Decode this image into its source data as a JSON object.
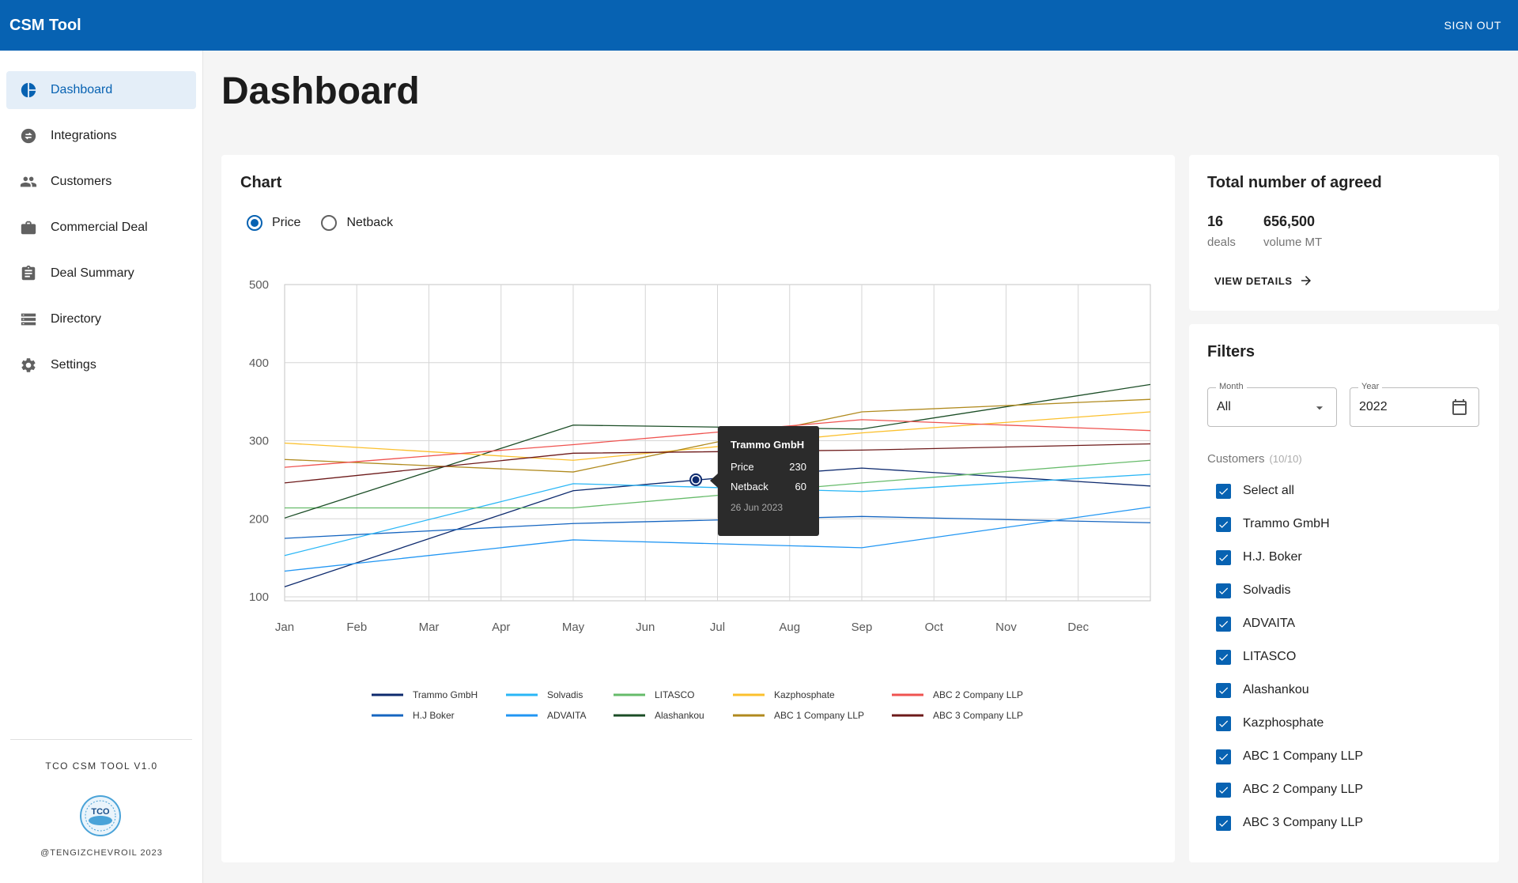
{
  "app": {
    "title": "CSM Tool",
    "sign_out": "SIGN OUT"
  },
  "sidebar": {
    "items": [
      {
        "label": "Dashboard",
        "icon": "pie-chart-icon",
        "active": true
      },
      {
        "label": "Integrations",
        "icon": "swap-icon",
        "active": false
      },
      {
        "label": "Customers",
        "icon": "people-icon",
        "active": false
      },
      {
        "label": "Commercial Deal",
        "icon": "briefcase-icon",
        "active": false
      },
      {
        "label": "Deal Summary",
        "icon": "clipboard-icon",
        "active": false
      },
      {
        "label": "Directory",
        "icon": "list-icon",
        "active": false
      },
      {
        "label": "Settings",
        "icon": "gear-icon",
        "active": false
      }
    ],
    "version": "TCO CSM TOOL V1.0",
    "logo_text": "TCO",
    "copyright": "@TENGIZCHEVROIL 2023"
  },
  "page": {
    "title": "Dashboard"
  },
  "chart_card": {
    "title": "Chart",
    "radio": {
      "price": "Price",
      "netback": "Netback",
      "selected": "Price"
    }
  },
  "tooltip": {
    "title": "Trammo GmbH",
    "price_label": "Price",
    "price_value": "230",
    "netback_label": "Netback",
    "netback_value": "60",
    "date": "26 Jun 2023"
  },
  "chart_data": {
    "type": "line",
    "categories": [
      "Jan",
      "Feb",
      "Mar",
      "Apr",
      "May",
      "Jun",
      "Jul",
      "Aug",
      "Sep",
      "Oct",
      "Nov",
      "Dec"
    ],
    "y_ticks": [
      100,
      200,
      300,
      400,
      500
    ],
    "ylim": [
      95,
      500
    ],
    "grid": true,
    "legend_position": "bottom",
    "series": [
      {
        "name": "Trammo GmbH",
        "color": "#0d2a6e",
        "points": [
          [
            0,
            113
          ],
          [
            4,
            236
          ],
          [
            6,
            252
          ],
          [
            8,
            265
          ],
          [
            12,
            242
          ]
        ]
      },
      {
        "name": "H.J Boker",
        "color": "#1565c0",
        "points": [
          [
            0,
            175
          ],
          [
            4,
            194
          ],
          [
            8,
            203
          ],
          [
            12,
            195
          ]
        ]
      },
      {
        "name": "Solvadis",
        "color": "#29b6f6",
        "points": [
          [
            0,
            153
          ],
          [
            4,
            245
          ],
          [
            6,
            240
          ],
          [
            8,
            235
          ],
          [
            12,
            257
          ]
        ]
      },
      {
        "name": "ADVAITA",
        "color": "#2196f3",
        "points": [
          [
            0,
            133
          ],
          [
            4,
            173
          ],
          [
            8,
            163
          ],
          [
            12,
            215
          ]
        ]
      },
      {
        "name": "LITASCO",
        "color": "#66bb6a",
        "points": [
          [
            0,
            214
          ],
          [
            4,
            214
          ],
          [
            8,
            246
          ],
          [
            12,
            275
          ]
        ]
      },
      {
        "name": "Alashankou",
        "color": "#1b4d26",
        "points": [
          [
            0,
            201
          ],
          [
            4,
            320
          ],
          [
            8,
            315
          ],
          [
            12,
            372
          ]
        ]
      },
      {
        "name": "Kazphosphate",
        "color": "#fbc02d",
        "points": [
          [
            0,
            297
          ],
          [
            4,
            275
          ],
          [
            8,
            310
          ],
          [
            12,
            337
          ]
        ]
      },
      {
        "name": "ABC 1 Company LLP",
        "color": "#b08a1e",
        "points": [
          [
            0,
            276
          ],
          [
            4,
            260
          ],
          [
            8,
            337
          ],
          [
            12,
            353
          ]
        ]
      },
      {
        "name": "ABC 2 Company LLP",
        "color": "#ef5350",
        "points": [
          [
            0,
            266
          ],
          [
            4,
            295
          ],
          [
            8,
            327
          ],
          [
            12,
            313
          ]
        ]
      },
      {
        "name": "ABC 3 Company LLP",
        "color": "#6d1a1a",
        "points": [
          [
            0,
            246
          ],
          [
            4,
            284
          ],
          [
            8,
            288
          ],
          [
            12,
            296
          ]
        ]
      }
    ],
    "highlight": {
      "series": "Trammo GmbH",
      "x": 5.7,
      "y": 250
    }
  },
  "total_card": {
    "title": "Total number of agreed",
    "deals_value": "16",
    "deals_label": "deals",
    "volume_value": "656,500",
    "volume_label": "volume MT",
    "view_details": "VIEW DETAILS"
  },
  "filters": {
    "title": "Filters",
    "month_label": "Month",
    "month_value": "All",
    "year_label": "Year",
    "year_value": "2022",
    "customers_label": "Customers",
    "customers_count": "(10/10)",
    "checkboxes": [
      "Select all",
      "Trammo GmbH",
      "H.J. Boker",
      "Solvadis",
      "ADVAITA",
      "LITASCO",
      "Alashankou",
      "Kazphosphate",
      "ABC 1 Company LLP",
      "ABC 2 Company LLP",
      "ABC 3 Company LLP"
    ]
  }
}
